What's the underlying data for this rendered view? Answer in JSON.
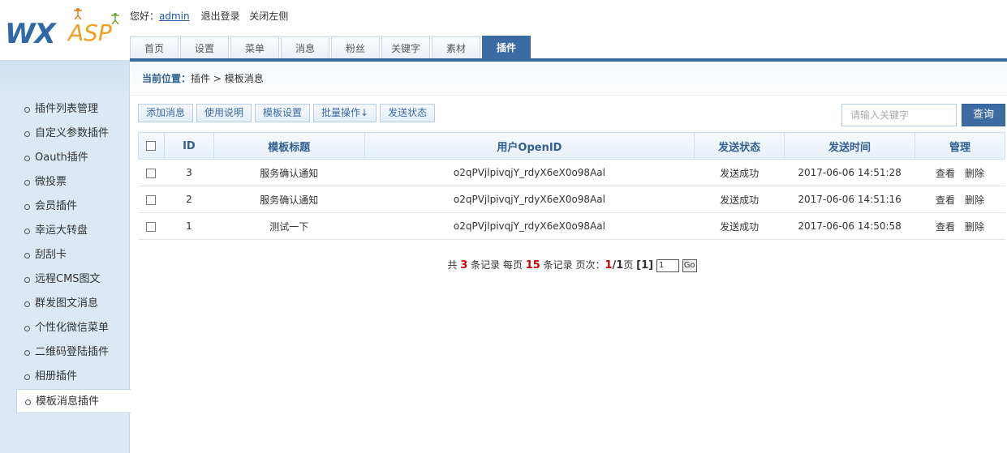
{
  "header": {
    "logo_wx": "WX",
    "logo_asp": "ASP",
    "greeting": "您好：",
    "username": "admin",
    "logout": "退出登录",
    "close_left": "关闭左侧"
  },
  "tabs": [
    {
      "label": "首页"
    },
    {
      "label": "设置"
    },
    {
      "label": "菜单"
    },
    {
      "label": "消息"
    },
    {
      "label": "粉丝"
    },
    {
      "label": "关键字"
    },
    {
      "label": "素材"
    },
    {
      "label": "插件",
      "active": true
    }
  ],
  "sidebar": {
    "items": [
      {
        "label": "插件列表管理"
      },
      {
        "label": "自定义参数插件"
      },
      {
        "label": "Oauth插件"
      },
      {
        "label": "微投票"
      },
      {
        "label": "会员插件"
      },
      {
        "label": "幸运大转盘"
      },
      {
        "label": "刮刮卡"
      },
      {
        "label": "远程CMS图文"
      },
      {
        "label": "群发图文消息"
      },
      {
        "label": "个性化微信菜单"
      },
      {
        "label": "二维码登陆插件"
      },
      {
        "label": "相册插件"
      },
      {
        "label": "模板消息插件",
        "active": true
      }
    ]
  },
  "breadcrumb": {
    "label": "当前位置：",
    "path": "插件 > 模板消息"
  },
  "toolbar": {
    "add": "添加消息",
    "help": "使用说明",
    "template": "模板设置",
    "batch": "批量操作↓",
    "status": "发送状态"
  },
  "search": {
    "placeholder": "请输入关键字",
    "button": "查询"
  },
  "table": {
    "headers": {
      "id": "ID",
      "title": "模板标题",
      "openid": "用户OpenID",
      "status": "发送状态",
      "time": "发送时间",
      "manage": "管理"
    },
    "rows": [
      {
        "id": "3",
        "title": "服务确认通知",
        "openid": "o2qPVjlpivqjY_rdyX6eX0o98Aal",
        "status": "发送成功",
        "time": "2017-06-06 14:51:28",
        "view": "查看",
        "delete": "删除"
      },
      {
        "id": "2",
        "title": "服务确认通知",
        "openid": "o2qPVjlpivqjY_rdyX6eX0o98Aal",
        "status": "发送成功",
        "time": "2017-06-06 14:51:16",
        "view": "查看",
        "delete": "删除"
      },
      {
        "id": "1",
        "title": "测试一下",
        "openid": "o2qPVjlpivqjY_rdyX6eX0o98Aal",
        "status": "发送成功",
        "time": "2017-06-06 14:50:58",
        "view": "查看",
        "delete": "删除"
      }
    ]
  },
  "pager": {
    "prefix": "共",
    "total": "3",
    "records": "条记录 每页",
    "per_page": "15",
    "records2": "条记录 页次：",
    "current": "1",
    "slash": "/",
    "pages": "1",
    "page_word": "页",
    "page_link": "[1]",
    "input_value": "1",
    "go": "Go"
  },
  "colors": {
    "accent": "#3c6aa3",
    "sidebar_bg": "#dbe9f6",
    "highlight_red": "#cc0000"
  }
}
